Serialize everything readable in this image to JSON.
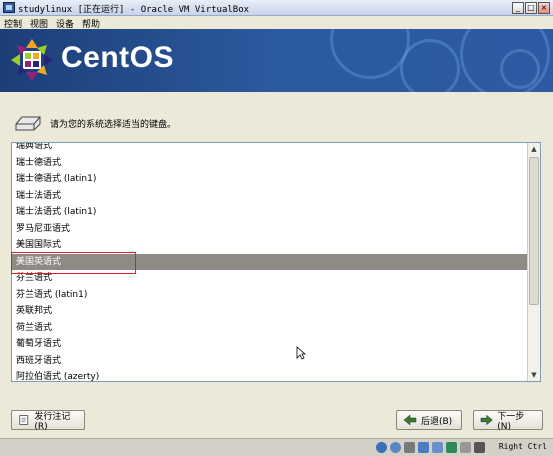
{
  "window": {
    "title": "studylinux [正在运行] - Oracle VM VirtualBox",
    "min_symbol": "_",
    "max_symbol": "□",
    "close_symbol": "×"
  },
  "menu": [
    "控制",
    "视图",
    "设备",
    "帮助"
  ],
  "banner": {
    "logo_text": "CentOS"
  },
  "prompt": "请为您的系统选择适当的键盘。",
  "keyboard_list": {
    "items": [
      "瑞典语式",
      "瑞士德语式",
      "瑞士德语式 (latin1)",
      "瑞士法语式",
      "瑞士法语式 (latin1)",
      "罗马尼亚语式",
      "美国国际式",
      "美国英语式",
      "芬兰语式",
      "芬兰语式 (latin1)",
      "英联邦式",
      "荷兰语式",
      "葡萄牙语式",
      "西班牙语式",
      "阿拉伯语式 (azerty)"
    ],
    "selected": "美国英语式"
  },
  "buttons": {
    "release_notes": "发行注记(R)",
    "back": "后退(B)",
    "next": "下一步(N)"
  },
  "statusbar": {
    "host_key": "Right Ctrl"
  },
  "colors": {
    "selection": "#8e8b84",
    "highlight_box": "#e02020",
    "banner": "#2c5a9f"
  }
}
